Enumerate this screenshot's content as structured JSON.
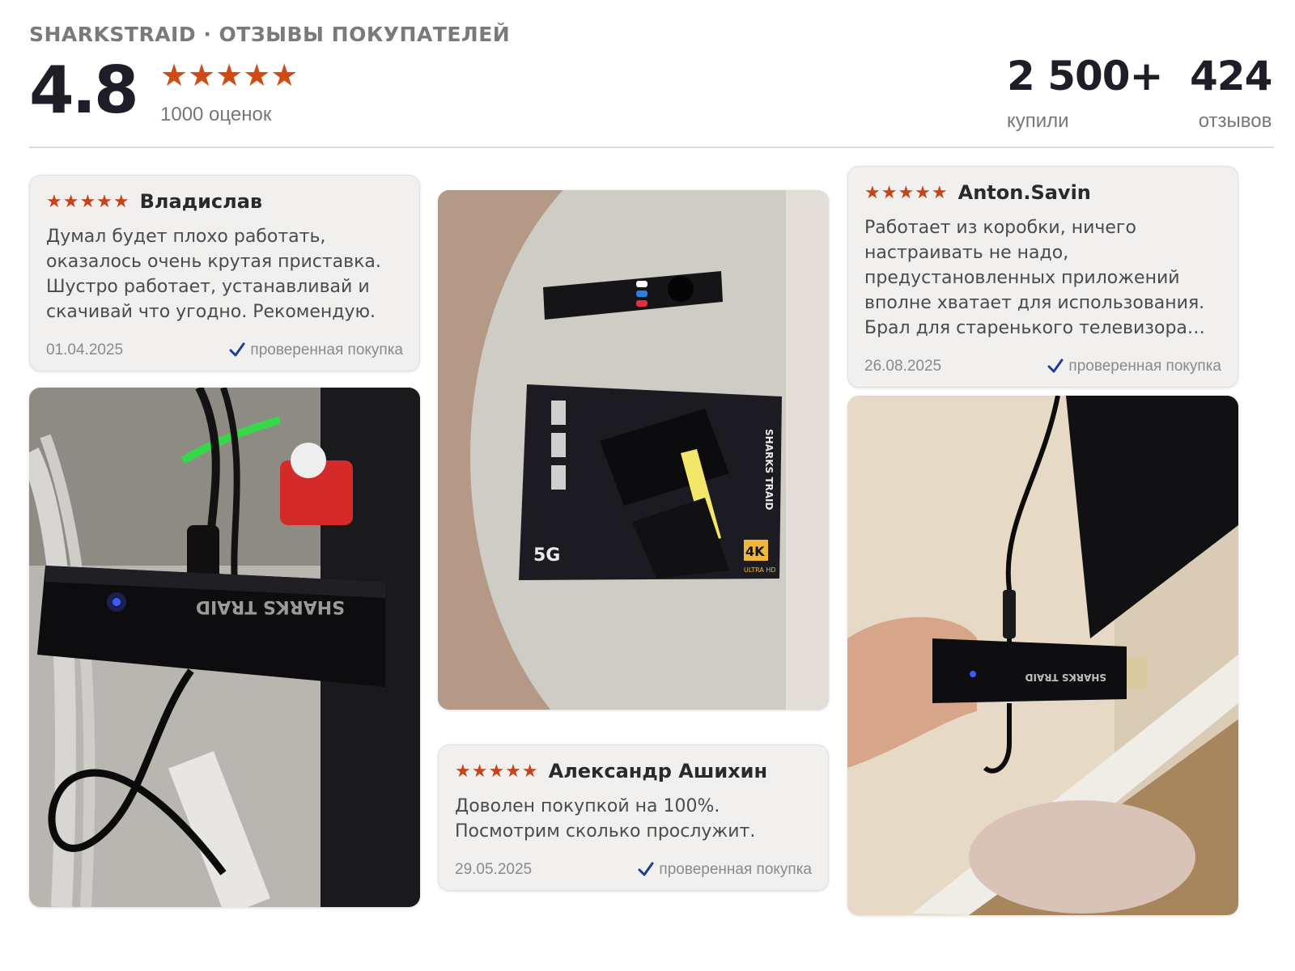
{
  "header": {
    "brand": "SHARKSTRAID · ОТЗЫВЫ ПОКУПАТЕЛЕЙ",
    "rating": "4.8",
    "stars": "★★★★★",
    "ratings_count": "1000 оценок",
    "bought_value": "2 500+",
    "bought_label": "купили",
    "reviews_value": "424",
    "reviews_label": "отзывов"
  },
  "colors": {
    "accent_star": "#c6441a",
    "check": "#1c3f8f",
    "heading": "#1e1e28"
  },
  "reviews": [
    {
      "stars": "★★★★★",
      "author": "Владислав",
      "text": "Думал будет плохо работать, оказалось очень крутая приставка. Шустро работает, устанавливай и скачивай что угодно. Рекомендую.",
      "date": "01.04.2025",
      "verified": "проверенная покупка"
    },
    {
      "stars": "★★★★★",
      "author": "Александр Ашихин",
      "text": "Доволен покупкой на 100%. Посмотрим сколько прослужит.",
      "date": "29.05.2025",
      "verified": "проверенная покупка"
    },
    {
      "stars": "★★★★★",
      "author": "Anton.Savin",
      "text": "Работает из коробки, ничего настраивать не надо, предустановленных приложений вполне хватает для использования. Брал для старенького телевизора на...",
      "date": "26.08.2025",
      "verified": "проверенная покупка"
    }
  ],
  "photos": {
    "brand_mark": "SHARKS TRAID",
    "box_badge_res": "4K",
    "box_badge_res_sub": "ULTRA HD",
    "box_badge_net": "5G"
  },
  "icons": [
    "star-icon",
    "check-icon"
  ]
}
